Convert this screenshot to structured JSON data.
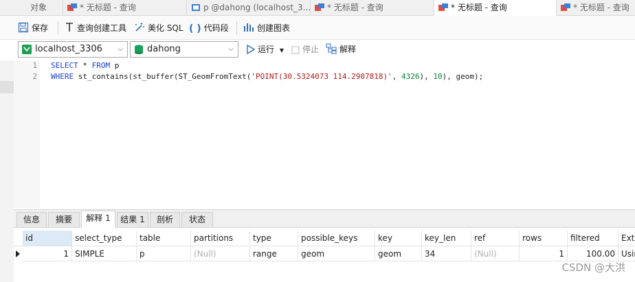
{
  "tabs": {
    "objects": "对象",
    "items": [
      "* 无标题 - 查询",
      "p @dahong (localhost_3...",
      "* 无标题 - 查询",
      "* 无标题 - 查询",
      "* 无标题 - 查询"
    ]
  },
  "toolbar": {
    "save": "保存",
    "query_builder": "查询创建工具",
    "beautify": "美化 SQL",
    "snippet": "代码段",
    "create_chart": "创建图表"
  },
  "toolbar2": {
    "connection": "localhost_3306",
    "database": "dahong",
    "run": "运行",
    "stop": "停止",
    "explain": "解释"
  },
  "editor": {
    "line_numbers": [
      "1",
      "2"
    ],
    "line1": {
      "kw1": "SELECT",
      "mid": " * ",
      "kw2": "FROM",
      "rest": " p"
    },
    "line2": {
      "kw": "WHERE",
      "a": " st_contains(st_buffer(ST_GeomFromText(",
      "str": "'POINT(30.5324073 114.2907818)'",
      "b": ", ",
      "n1": "4326",
      "c": "), ",
      "n2": "10",
      "d": "), geom);"
    }
  },
  "result_tabs": [
    "信息",
    "摘要",
    "解释 1",
    "结果 1",
    "剖析",
    "状态"
  ],
  "grid": {
    "columns": [
      "id",
      "select_type",
      "table",
      "partitions",
      "type",
      "possible_keys",
      "key",
      "key_len",
      "ref",
      "rows",
      "filtered",
      "Extra"
    ],
    "row": [
      "1",
      "SIMPLE",
      "p",
      "(Null)",
      "range",
      "geom",
      "geom",
      "34",
      "(Null)",
      "1",
      "100.00",
      "Using"
    ]
  },
  "watermark": "CSDN @大洪",
  "colors": {
    "keyword": "#1a40d8",
    "string": "#b11b1b",
    "number": "#0a8a37",
    "null": "#b0b0b0"
  }
}
